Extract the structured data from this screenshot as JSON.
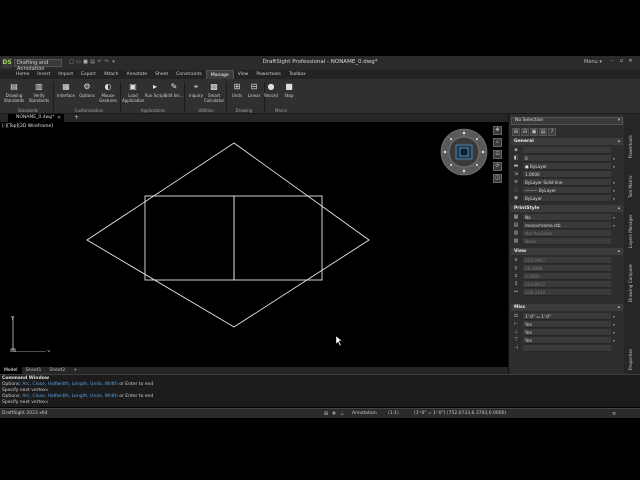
{
  "titlebar": {
    "logo": "DS",
    "workspace": "Drafting and Annotation",
    "title": "DraftSight Professional - NONAME_0.dwg*",
    "menu_label": "Menu",
    "quick_access": [
      "new-icon",
      "open-icon",
      "save-icon",
      "print-icon",
      "undo-icon",
      "redo-icon"
    ]
  },
  "ribbon_tabs": [
    "Home",
    "Insert",
    "Import",
    "Export",
    "Attach",
    "Annotate",
    "Sheet",
    "Constraints",
    "Manage",
    "View",
    "Powertools",
    "Toolbox"
  ],
  "active_ribbon_tab": "Manage",
  "ribbon": {
    "buttons": [
      {
        "label": "Drawing Standards",
        "icon": "drawing-standards-icon"
      },
      {
        "label": "Verify Standards",
        "icon": "verify-standards-icon"
      },
      {
        "label": "Interface",
        "icon": "interface-icon"
      },
      {
        "label": "Options",
        "icon": "options-icon"
      },
      {
        "label": "Mouse Gestures",
        "icon": "mouse-gestures-icon"
      },
      {
        "label": "Load Application",
        "icon": "load-application-icon"
      },
      {
        "label": "Run Script",
        "icon": "run-script-icon"
      },
      {
        "label": "Edit Ins...",
        "icon": "edit-ins-icon"
      },
      {
        "label": "Inquiry",
        "icon": "inquiry-icon"
      },
      {
        "label": "Smart Calculator",
        "icon": "smart-calculator-icon"
      },
      {
        "label": "Units",
        "icon": "units-icon"
      },
      {
        "label": "Linear",
        "icon": "linear-icon"
      },
      {
        "label": "Record",
        "icon": "record-icon"
      },
      {
        "label": "Stop",
        "icon": "stop-icon"
      }
    ],
    "groups": [
      "Standards",
      "Customization",
      "Applications",
      "Utilities",
      "Drawing",
      "Macro"
    ]
  },
  "document_tab": "NONAME_0.dwg*",
  "viewport_label": "[-][Top][2D Wireframe]",
  "layout_tabs": [
    "Model",
    "Sheet1",
    "Sheet2"
  ],
  "active_layout_tab": "Model",
  "command_window": {
    "header": "Command Window",
    "lines": [
      {
        "prefix": "Options: ",
        "options": "Arc, Close, Halfwidth, Length, Undo, Width",
        "suffix": " or Enter to end"
      },
      {
        "prefix": "Specify next vertex»",
        "options": "",
        "suffix": ""
      },
      {
        "prefix": "Options: ",
        "options": "Arc, Close, Halfwidth, Length, Undo, Width",
        "suffix": " or Enter to end"
      },
      {
        "prefix": "Specify next vertex»",
        "options": "",
        "suffix": ""
      }
    ]
  },
  "statusbar": {
    "app_name": "DraftSight 2023 x64",
    "annotation": "Annotation",
    "scale": "(1:1)",
    "coordinates": "(1'-0\"  = 1'-0\")  (752.0733,6.3703,0.0000)"
  },
  "properties": {
    "selection": "No Selection",
    "sections": [
      {
        "title": "General",
        "rows": [
          {
            "icon": "color-icon",
            "value": "",
            "dim": false
          },
          {
            "icon": "layer-icon",
            "value": "0",
            "dim": false
          },
          {
            "icon": "linetype-icon",
            "value": "● ByLayer",
            "dim": false
          },
          {
            "icon": "scale-icon",
            "value": "1.0000",
            "dim": false
          },
          {
            "icon": "lineweight-icon",
            "value": "ByLayer   Solid line",
            "dim": false
          },
          {
            "icon": "transparency-icon",
            "value": "——— ByLayer",
            "dim": false
          },
          {
            "icon": "thickness-icon",
            "value": "ByLayer",
            "dim": false
          }
        ]
      },
      {
        "title": "PrintStyle",
        "rows": [
          {
            "icon": "print-style-icon",
            "value": "No",
            "dim": false
          },
          {
            "icon": "print-table-icon",
            "value": "monochrome.ctb",
            "dim": false
          },
          {
            "icon": "print-attached-icon",
            "value": "Not Available",
            "dim": true
          },
          {
            "icon": "print-table-type-icon",
            "value": "None",
            "dim": true
          }
        ]
      },
      {
        "title": "View",
        "rows": [
          {
            "icon": "center-x-icon",
            "value": "215.0967",
            "dim": true
          },
          {
            "icon": "center-y-icon",
            "value": "26.1886",
            "dim": true
          },
          {
            "icon": "center-z-icon",
            "value": "0.0000",
            "dim": true
          },
          {
            "icon": "height-icon",
            "value": "224.8072",
            "dim": true
          },
          {
            "icon": "width-icon",
            "value": "338.3108",
            "dim": true
          }
        ]
      },
      {
        "title": "Misc",
        "rows": [
          {
            "icon": "annotation-scale-icon",
            "value": "1'-0\" = 1'-0\"",
            "dim": false
          },
          {
            "icon": "ucs-icon-on-icon",
            "value": "Yes",
            "dim": false
          },
          {
            "icon": "ucs-origin-icon",
            "value": "Yes",
            "dim": false
          },
          {
            "icon": "ucs-per-viewport-icon",
            "value": "Yes",
            "dim": false
          },
          {
            "icon": "ucs-name-icon",
            "value": "",
            "dim": false
          }
        ]
      }
    ]
  },
  "side_tabs": [
    "Properties",
    "Layers Manager",
    "Tool Matrix",
    "Drawing Compare",
    "Powertools"
  ]
}
